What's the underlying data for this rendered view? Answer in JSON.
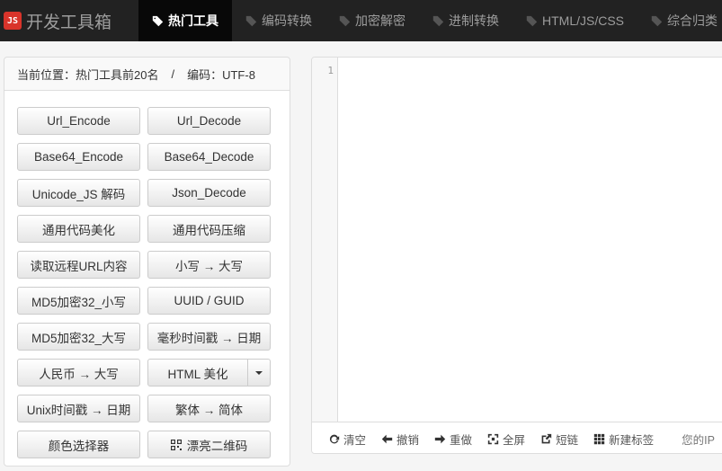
{
  "brand": {
    "logo": "JS",
    "title": "开发工具箱"
  },
  "nav": [
    {
      "label": "热门工具",
      "active": true
    },
    {
      "label": "编码转换"
    },
    {
      "label": "加密解密"
    },
    {
      "label": "进制转换"
    },
    {
      "label": "HTML/JS/CSS"
    },
    {
      "label": "综合归类"
    }
  ],
  "panel": {
    "location": "当前位置：热门工具前20名",
    "separator": "/",
    "encoding": "编码：UTF-8"
  },
  "buttons": [
    "Url_Encode",
    "Url_Decode",
    "Base64_Encode",
    "Base64_Decode",
    "Unicode_JS 解码",
    "Json_Decode",
    "通用代码美化",
    "通用代码压缩",
    "读取远程URL内容",
    "小写 → 大写",
    "MD5加密32_小写",
    "UUID / GUID",
    "MD5加密32_大写",
    "毫秒时间戳 → 日期",
    "人民币 → 大写",
    "HTML 美化",
    "Unix时间戳 → 日期",
    "繁体 → 简体",
    "颜色选择器",
    "漂亮二维码"
  ],
  "editor": {
    "line_number": "1",
    "toolbar": [
      "清空",
      "撤销",
      "重做",
      "全屏",
      "短链",
      "新建标签"
    ],
    "ip_label": "您的IP"
  },
  "colors": {
    "navbar": "#222222",
    "active_nav": "#080808",
    "logo": "#d9342b"
  }
}
